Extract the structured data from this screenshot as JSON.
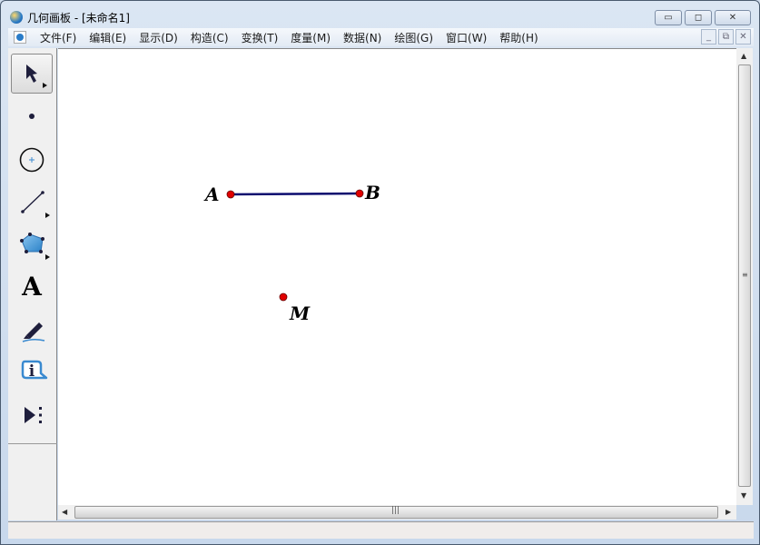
{
  "window": {
    "title": "几何画板 - [未命名1]",
    "controls": {
      "minimize": "▭",
      "maximize": "◻",
      "close": "✕"
    }
  },
  "menu": {
    "items": [
      "文件(F)",
      "编辑(E)",
      "显示(D)",
      "构造(C)",
      "变换(T)",
      "度量(M)",
      "数据(N)",
      "绘图(G)",
      "窗口(W)",
      "帮助(H)"
    ]
  },
  "toolbar": {
    "tools": [
      "selection-arrow",
      "point",
      "compass",
      "straightedge",
      "polygon",
      "text",
      "marker",
      "information",
      "custom-tools"
    ]
  },
  "canvas": {
    "points": [
      {
        "label": "A",
        "color": "#e00000"
      },
      {
        "label": "B",
        "color": "#e00000"
      },
      {
        "label": "M",
        "color": "#e00000"
      }
    ],
    "segment": {
      "from": "A",
      "to": "B",
      "color": "#0a0a6e"
    },
    "text_tool_glyph": "A"
  }
}
